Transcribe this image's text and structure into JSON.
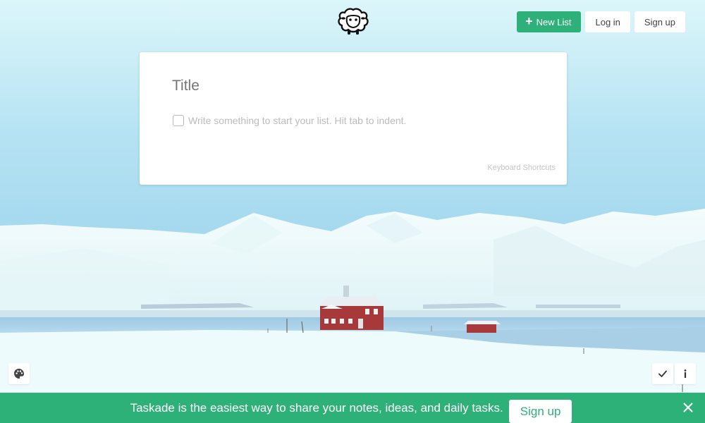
{
  "header": {
    "new_list_label": "New List",
    "login_label": "Log in",
    "signup_label": "Sign up"
  },
  "editor": {
    "title_placeholder": "Title",
    "item_placeholder": "Write something to start your list. Hit tab to indent.",
    "shortcuts_label": "Keyboard Shortcuts"
  },
  "banner": {
    "text": "Taskade is the easiest way to share your notes, ideas, and daily tasks.",
    "signup_label": "Sign up"
  },
  "colors": {
    "brand_green": "#2eb079",
    "card_bg": "#ffffff",
    "placeholder_gray": "#c5c5c5"
  },
  "icons": {
    "logo": "sheep-logo-icon",
    "new_list": "plus-icon",
    "palette": "palette-icon",
    "check": "checkmark-icon",
    "info": "info-icon",
    "close": "close-icon"
  }
}
